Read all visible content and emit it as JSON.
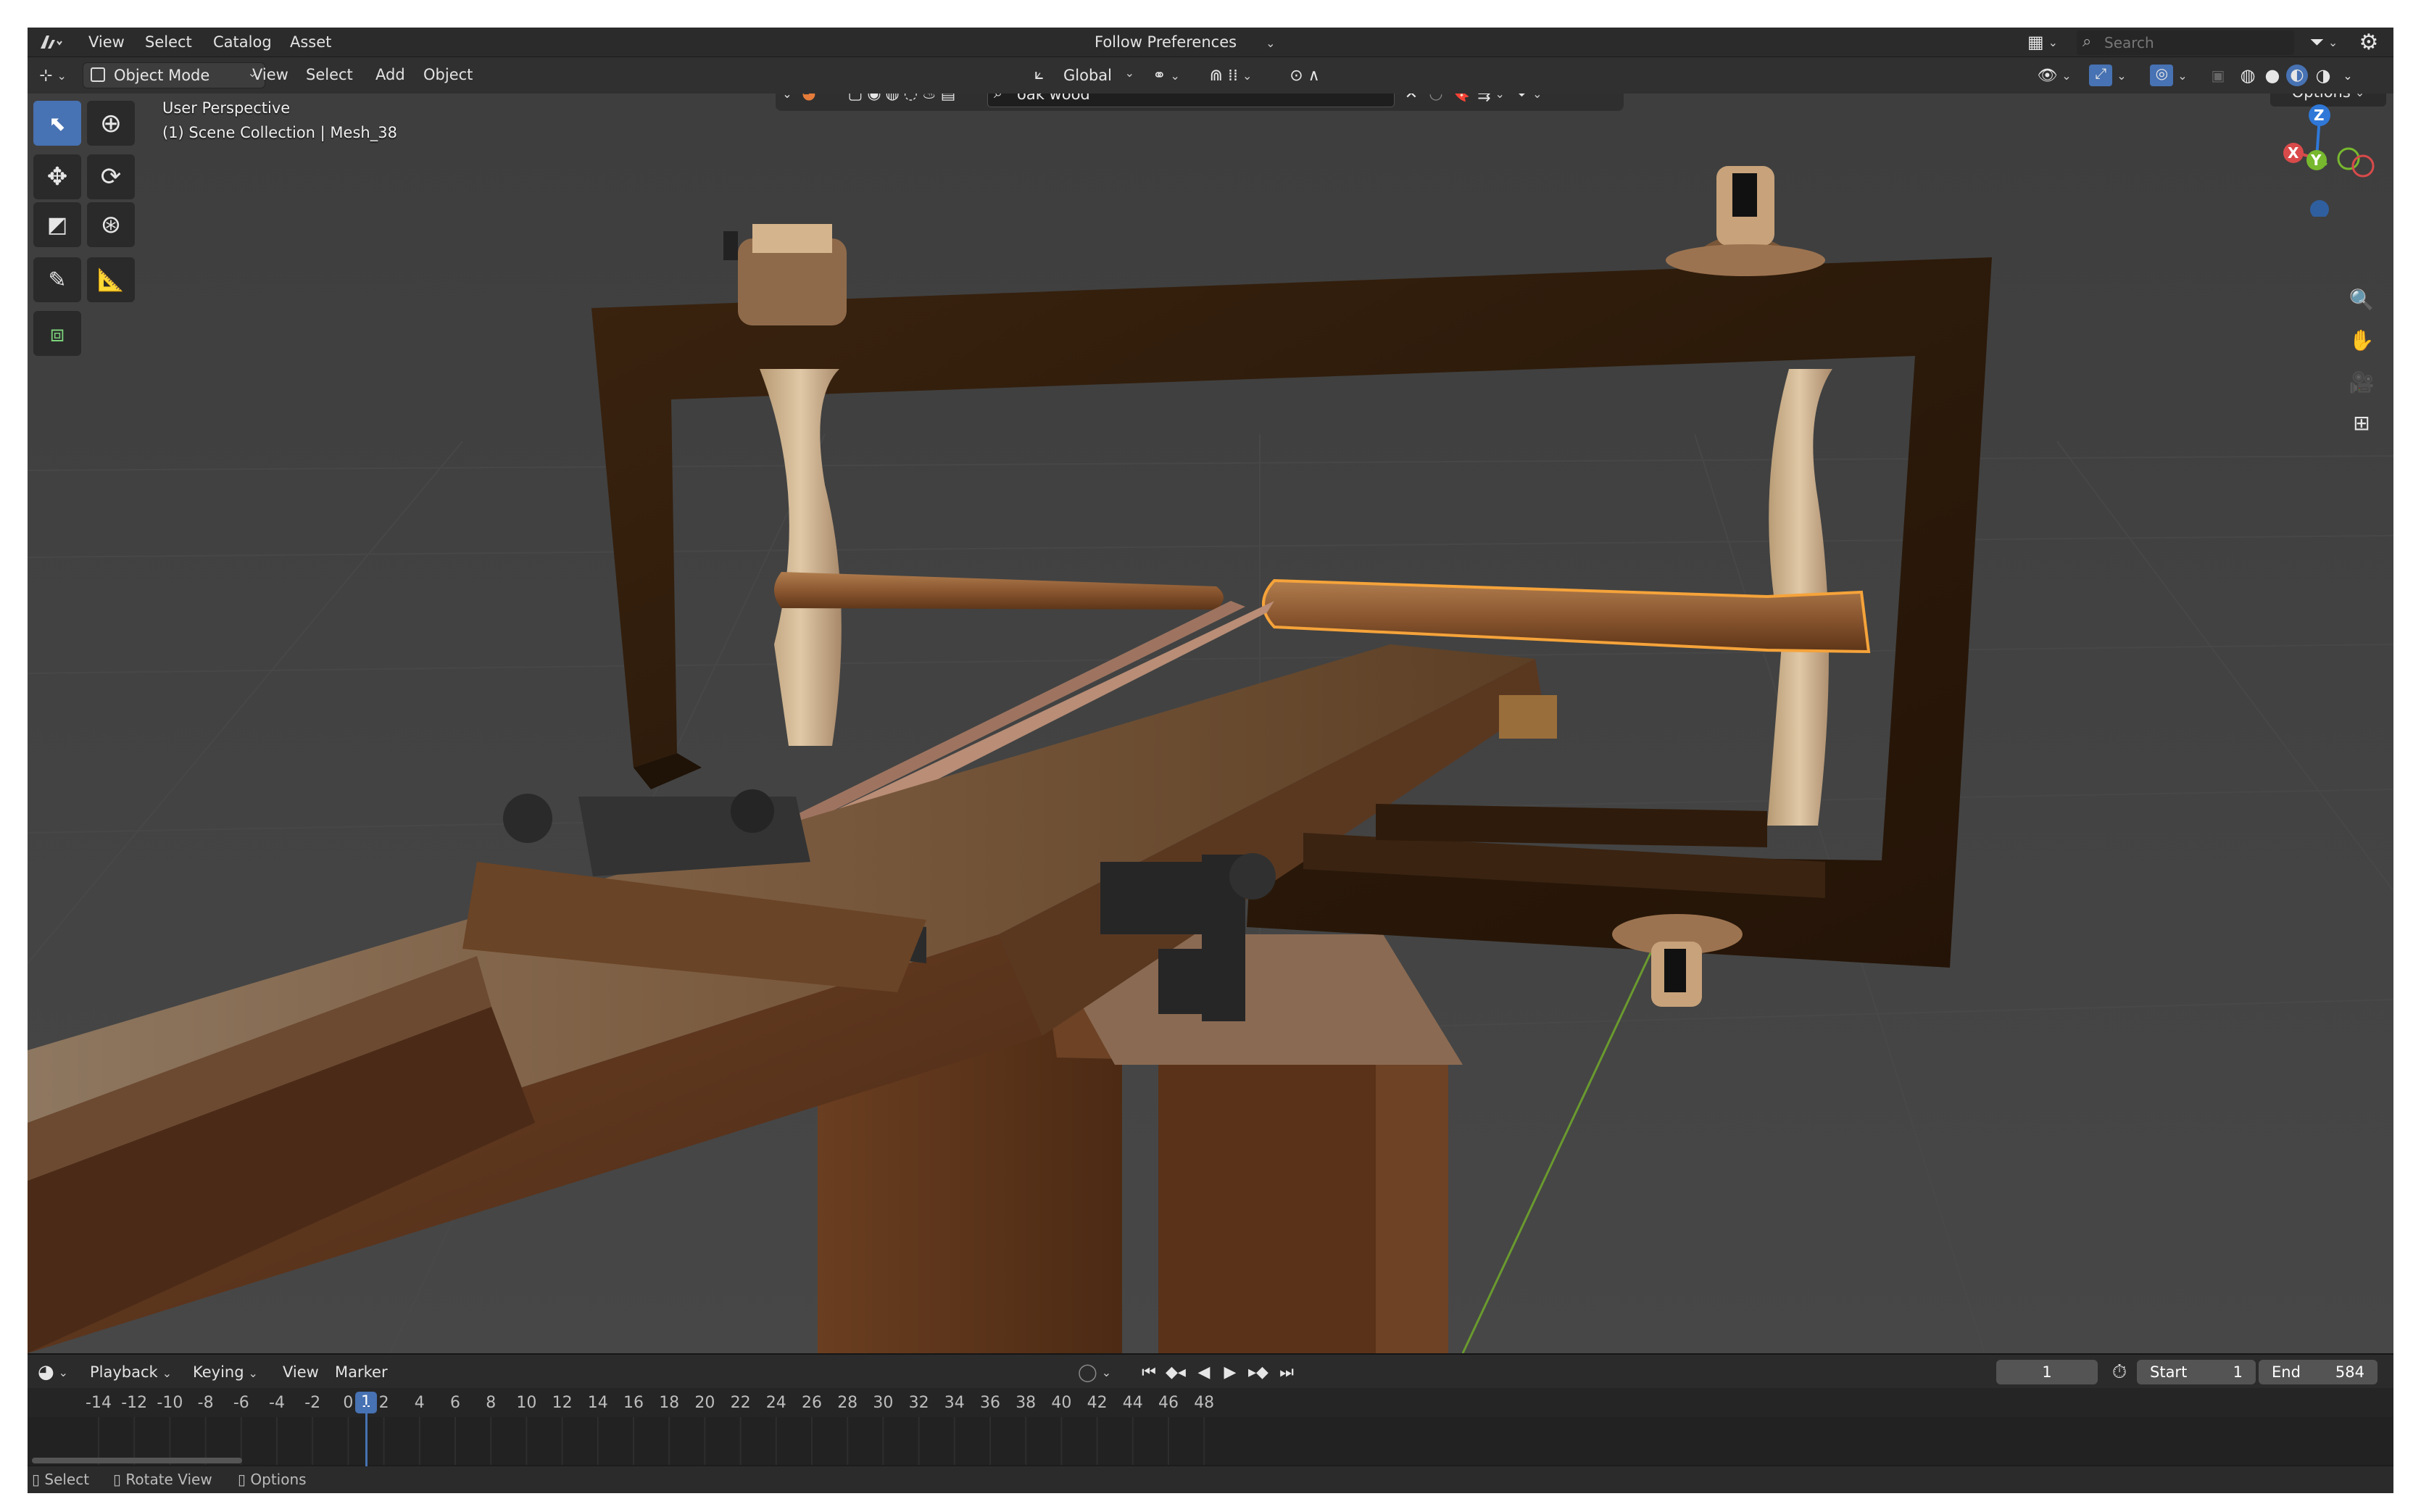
{
  "topbar": {
    "menu": [
      "View",
      "Select",
      "Catalog",
      "Asset"
    ],
    "library_selector": "Follow Preferences",
    "search_placeholder": "Search"
  },
  "viewport_header": {
    "mode": "Object Mode",
    "menu": [
      "View",
      "Select",
      "Add",
      "Object"
    ],
    "orientation": "Global",
    "asset_search_value": "oak wood",
    "options_label": "Options"
  },
  "viewport": {
    "perspective_label": "User Perspective",
    "collection_label": "(1) Scene Collection | Mesh_38",
    "gizmo_axes": [
      "Z",
      "Y",
      "X"
    ]
  },
  "timeline": {
    "menu": [
      "Playback",
      "Keying",
      "View",
      "Marker"
    ],
    "current_frame": "1",
    "start_label": "Start",
    "start_value": "1",
    "end_label": "End",
    "end_value": "584",
    "ruler_ticks": [
      "-14",
      "-12",
      "-10",
      "-8",
      "-6",
      "-4",
      "-2",
      "0",
      "1",
      "2",
      "4",
      "6",
      "8",
      "10",
      "12",
      "14",
      "16",
      "18",
      "20",
      "22",
      "24",
      "26",
      "28",
      "30",
      "32",
      "34",
      "36",
      "38",
      "40",
      "42",
      "44",
      "46",
      "48"
    ],
    "playhead_label": "1"
  },
  "statusbar": {
    "items": [
      "Select",
      "Rotate View",
      "Options"
    ]
  },
  "colors": {
    "accent": "#4772b3",
    "selection_outline": "#f5a33a",
    "viewport_bg": "#3b3b3b",
    "wood_dark": "#3a2310",
    "wood_mid": "#6b4022"
  }
}
